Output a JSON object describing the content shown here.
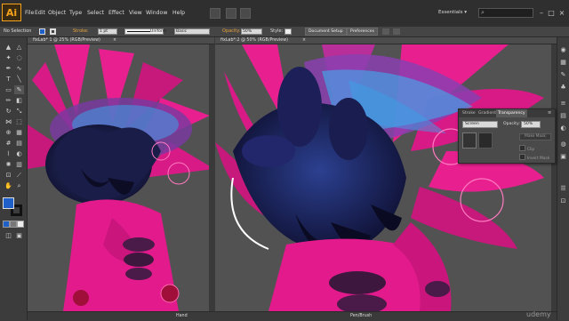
{
  "app": {
    "logo": "Ai"
  },
  "menu": [
    "File",
    "Edit",
    "Object",
    "Type",
    "Select",
    "Effect",
    "View",
    "Window",
    "Help"
  ],
  "header": {
    "workspace": "Essentials ▾",
    "search_placeholder": ""
  },
  "control_bar": {
    "selection": "No Selection",
    "stroke_label": "Stroke:",
    "stroke_weight": "1 pt",
    "brush": "Uniform",
    "style_basic": "Basic",
    "opacity_label": "Opacity:",
    "opacity_value": "50%",
    "style_label": "Style:",
    "document_setup": "Document Setup",
    "preferences": "Preferences"
  },
  "documents": [
    {
      "tab_title": "fixLab* 1 @ 25% (RGB/Preview)",
      "close": "×",
      "status": "Hand"
    },
    {
      "tab_title": "fixLab*:2 @ 50% (RGB/Preview)",
      "close": "×",
      "status": "Pen/Brush"
    }
  ],
  "transparency_panel": {
    "tabs": [
      "Stroke",
      "Gradient",
      "Transparency"
    ],
    "blend_mode": "Screen",
    "opacity_label": "Opacity:",
    "opacity_value": "50%",
    "make_mask": "Make Mask",
    "clip": "Clip",
    "invert_mask": "Invert Mask"
  },
  "watermark": "udemy",
  "colors": {
    "accent": "#f7a21b",
    "fill": "#1e5fc8",
    "pink": "#e8208f",
    "bg": "#525252"
  }
}
